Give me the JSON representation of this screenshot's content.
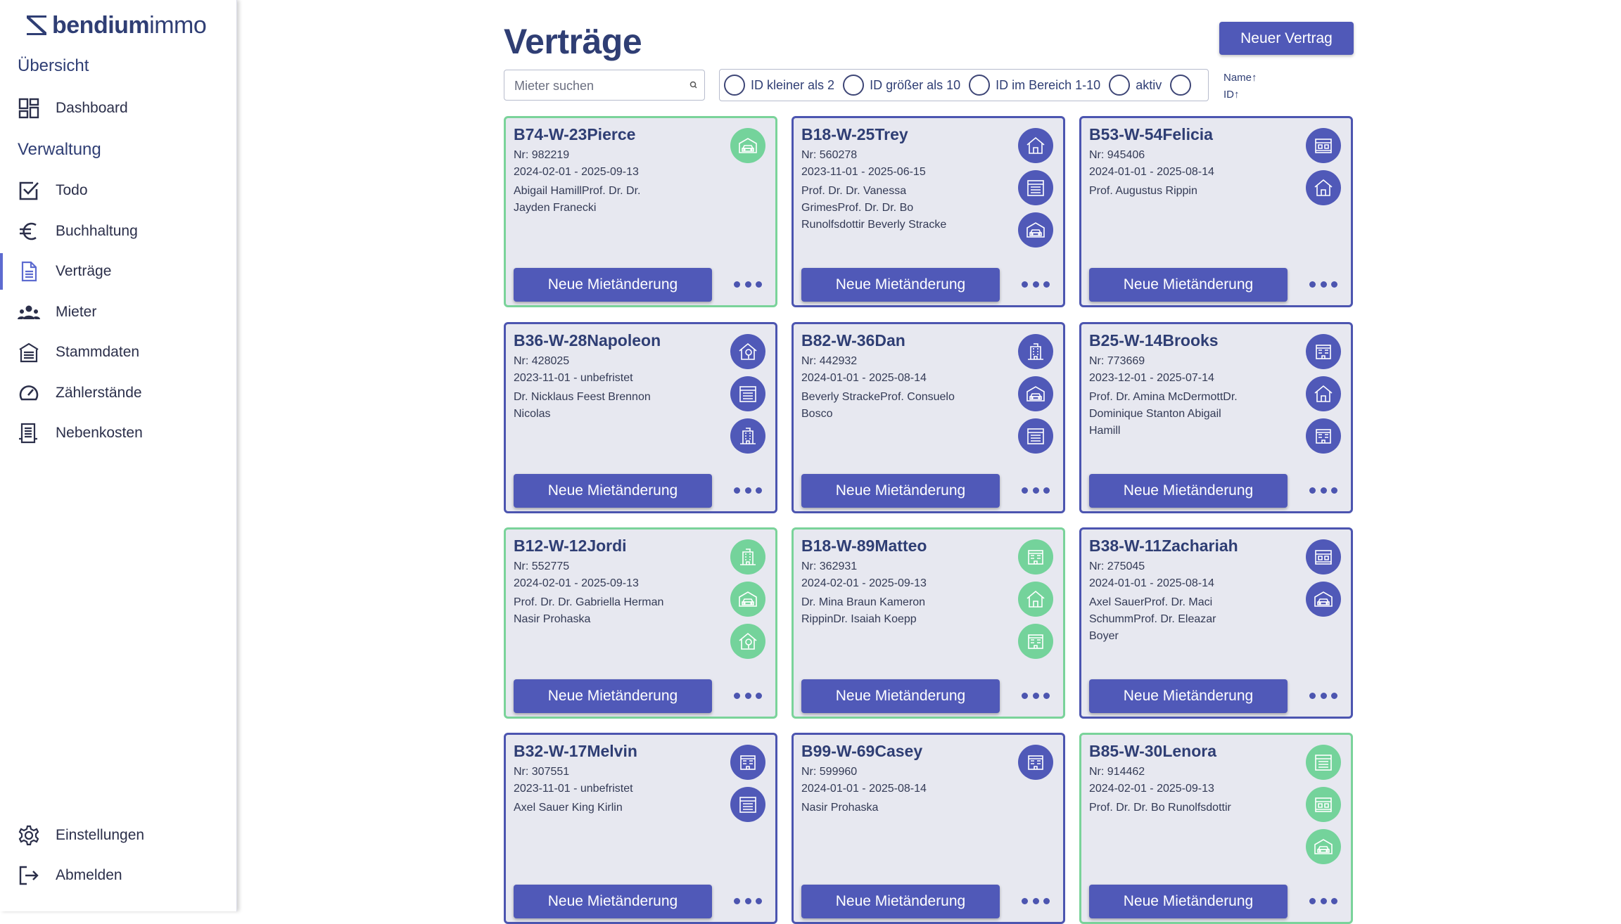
{
  "brand": {
    "bold": "bendium",
    "light": "immo"
  },
  "sidebar": {
    "section_overview": "Übersicht",
    "section_admin": "Verwaltung",
    "items": [
      {
        "label": "Dashboard",
        "icon": "dashboard-icon"
      },
      {
        "label": "Todo",
        "icon": "checkbox-icon"
      },
      {
        "label": "Buchhaltung",
        "icon": "euro-icon"
      },
      {
        "label": "Verträge",
        "icon": "document-icon",
        "active": true
      },
      {
        "label": "Mieter",
        "icon": "people-icon"
      },
      {
        "label": "Stammdaten",
        "icon": "building-icon"
      },
      {
        "label": "Zählerstände",
        "icon": "gauge-icon"
      },
      {
        "label": "Nebenkosten",
        "icon": "receipt-icon"
      }
    ],
    "settings": "Einstellungen",
    "logout": "Abmelden"
  },
  "header": {
    "title": "Verträge",
    "new_button": "Neuer Vertrag",
    "search_placeholder": "Mieter suchen",
    "filters": [
      "ID kleiner als 2",
      "ID größer als 10",
      "ID im Bereich 1-10",
      "aktiv",
      ""
    ],
    "sort": [
      "Name↑",
      "ID↑"
    ]
  },
  "card_button_label": "Neue Mietänderung",
  "colors": {
    "primary": "#5059b8",
    "active_green": "#74d39b",
    "title": "#2f3e74"
  },
  "cards": [
    {
      "title": "B74-W-23Pierce",
      "nr": "Nr: 982219",
      "period": "2024-02-01 - 2025-09-13",
      "tenants": "Abigail HamillProf. Dr. Dr. Jayden Franecki",
      "active": true,
      "icons": [
        "garage-icon"
      ]
    },
    {
      "title": "B18-W-25Trey",
      "nr": "Nr: 560278",
      "period": "2023-11-01 - 2025-06-15",
      "tenants": "Prof. Dr. Dr. Vanessa GrimesProf. Dr. Dr. Bo Runolfsdottir Beverly Stracke",
      "active": false,
      "icons": [
        "house-icon",
        "garage-box-icon",
        "garage-icon"
      ]
    },
    {
      "title": "B53-W-54Felicia",
      "nr": "Nr: 945406",
      "period": "2024-01-01 - 2025-08-14",
      "tenants": "Prof. Augustus Rippin",
      "active": false,
      "icons": [
        "shop-icon",
        "house-icon"
      ]
    },
    {
      "title": "B36-W-28Napoleon",
      "nr": "Nr: 428025",
      "period": "2023-11-01 - unbefristet",
      "tenants": "Dr. Nicklaus Feest Brennon Nicolas",
      "active": false,
      "icons": [
        "garden-icon",
        "garage-box-icon",
        "apartment-icon"
      ]
    },
    {
      "title": "B82-W-36Dan",
      "nr": "Nr: 442932",
      "period": "2024-01-01 - 2025-08-14",
      "tenants": "Beverly StrackeProf. Consuelo Bosco",
      "active": false,
      "icons": [
        "apartment-icon",
        "garage-icon",
        "garage-box-icon"
      ]
    },
    {
      "title": "B25-W-14Brooks",
      "nr": "Nr: 773669",
      "period": "2023-12-01 - 2025-07-14",
      "tenants": "Prof. Dr. Amina McDermottDr. Dominique Stanton Abigail Hamill",
      "active": false,
      "icons": [
        "office-icon",
        "house-icon",
        "office-icon"
      ]
    },
    {
      "title": "B12-W-12Jordi",
      "nr": "Nr: 552775",
      "period": "2024-02-01 - 2025-09-13",
      "tenants": "Prof. Dr. Dr. Gabriella Herman Nasir Prohaska",
      "active": true,
      "icons": [
        "apartment-icon",
        "garage-icon",
        "garden-icon"
      ]
    },
    {
      "title": "B18-W-89Matteo",
      "nr": "Nr: 362931",
      "period": "2024-02-01 - 2025-09-13",
      "tenants": "Dr. Mina Braun Kameron RippinDr. Isaiah Koepp",
      "active": true,
      "icons": [
        "office-icon",
        "house-icon",
        "office-icon"
      ]
    },
    {
      "title": "B38-W-11Zachariah",
      "nr": "Nr: 275045",
      "period": "2024-01-01 - 2025-08-14",
      "tenants": "Axel SauerProf. Dr. Maci SchummProf. Dr. Eleazar Boyer",
      "active": false,
      "icons": [
        "shop-icon",
        "garage-icon"
      ]
    },
    {
      "title": "B32-W-17Melvin",
      "nr": "Nr: 307551",
      "period": "2023-11-01 - unbefristet",
      "tenants": "Axel Sauer King Kirlin",
      "active": false,
      "icons": [
        "office-icon",
        "garage-box-icon"
      ]
    },
    {
      "title": "B99-W-69Casey",
      "nr": "Nr: 599960",
      "period": "2024-01-01 - 2025-08-14",
      "tenants": "Nasir Prohaska",
      "active": false,
      "icons": [
        "office-icon"
      ]
    },
    {
      "title": "B85-W-30Lenora",
      "nr": "Nr: 914462",
      "period": "2024-02-01 - 2025-09-13",
      "tenants": "Prof. Dr. Dr. Bo Runolfsdottir",
      "active": true,
      "icons": [
        "garage-box-icon",
        "shop-icon",
        "garage-icon"
      ]
    }
  ]
}
